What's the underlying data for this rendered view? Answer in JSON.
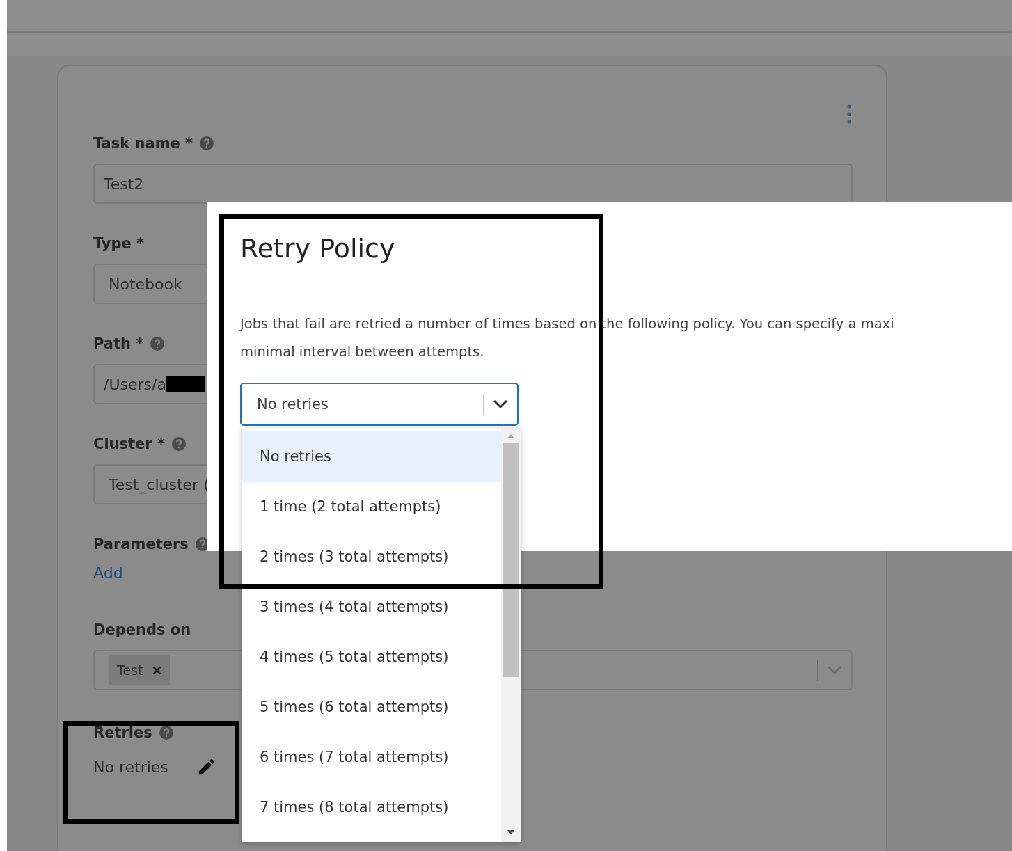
{
  "form": {
    "fields": [
      {
        "label": "Task name *",
        "help": true,
        "kind": "text",
        "value": "Test2"
      },
      {
        "label": "Type *",
        "help": false,
        "kind": "select",
        "value": "Notebook"
      },
      {
        "label": "Path *",
        "help": true,
        "kind": "text",
        "value": "/Users/a",
        "redacted": true
      },
      {
        "label": "Cluster *",
        "help": true,
        "kind": "select",
        "value": "Test_cluster ("
      },
      {
        "label": "Parameters",
        "help": true,
        "kind": "link",
        "link": "Add"
      },
      {
        "label": "Depends on",
        "help": false,
        "kind": "tags",
        "tags": [
          "Test"
        ]
      },
      {
        "label": "Retries",
        "help": true,
        "kind": "summary",
        "value": "No retries"
      }
    ]
  },
  "modal": {
    "title": "Retry Policy",
    "description_lines": [
      "Jobs that fail are retried a number of times based on the following policy. You can specify a maxi",
      "minimal interval between attempts."
    ],
    "select": {
      "value": "No retries"
    },
    "options": [
      {
        "label": "No retries",
        "selected": true
      },
      {
        "label": "1 time (2 total attempts)",
        "selected": false
      },
      {
        "label": "2 times (3 total attempts)",
        "selected": false
      },
      {
        "label": "3 times (4 total attempts)",
        "selected": false
      },
      {
        "label": "4 times (5 total attempts)",
        "selected": false
      },
      {
        "label": "5 times (6 total attempts)",
        "selected": false
      },
      {
        "label": "6 times (7 total attempts)",
        "selected": false
      },
      {
        "label": "7 times (8 total attempts)",
        "selected": false
      }
    ]
  }
}
